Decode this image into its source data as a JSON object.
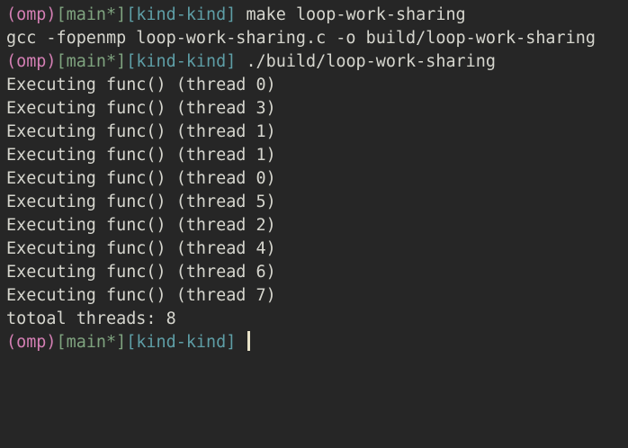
{
  "prompt": {
    "env": "(omp)",
    "branch": "[main*]",
    "context": "[kind-kind]"
  },
  "lines": [
    {
      "type": "prompt",
      "command": "make loop-work-sharing"
    },
    {
      "type": "output",
      "text": "gcc -fopenmp loop-work-sharing.c -o build/loop-work-sharing"
    },
    {
      "type": "prompt",
      "command": "./build/loop-work-sharing"
    },
    {
      "type": "output",
      "text": "Executing func() (thread 0)"
    },
    {
      "type": "output",
      "text": "Executing func() (thread 3)"
    },
    {
      "type": "output",
      "text": "Executing func() (thread 1)"
    },
    {
      "type": "output",
      "text": "Executing func() (thread 1)"
    },
    {
      "type": "output",
      "text": "Executing func() (thread 0)"
    },
    {
      "type": "output",
      "text": "Executing func() (thread 5)"
    },
    {
      "type": "output",
      "text": "Executing func() (thread 2)"
    },
    {
      "type": "output",
      "text": "Executing func() (thread 4)"
    },
    {
      "type": "output",
      "text": "Executing func() (thread 6)"
    },
    {
      "type": "output",
      "text": "Executing func() (thread 7)"
    },
    {
      "type": "output",
      "text": "totoal threads: 8"
    },
    {
      "type": "prompt",
      "command": "",
      "cursor": true
    }
  ],
  "colors": {
    "background": "#262626",
    "foreground": "#d6d6ce",
    "env": "#d47fb4",
    "branch": "#7fa37f",
    "context": "#5e9ea6",
    "cursor": "#e8e2c8"
  }
}
